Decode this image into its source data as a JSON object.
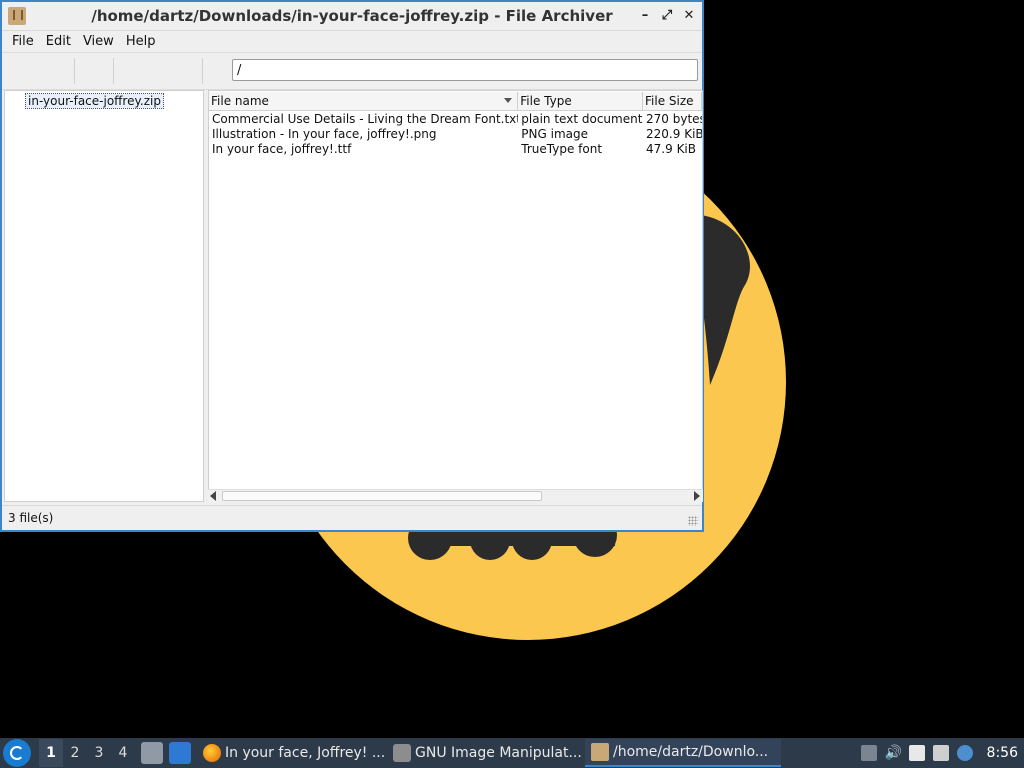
{
  "window": {
    "title": "/home/dartz/Downloads/in-your-face-joffrey.zip - File Archiver",
    "controls": {
      "minimize": "–",
      "maximize": "⤢",
      "close": "✕"
    }
  },
  "menu": [
    "File",
    "Edit",
    "View",
    "Help"
  ],
  "path": {
    "value": "/"
  },
  "tree": {
    "root_label": "in-your-face-joffrey.zip"
  },
  "columns": [
    "File name",
    "File Type",
    "File Size"
  ],
  "files": [
    {
      "name": "Commercial Use Details - Living the Dream Font.txt",
      "type": "plain text document",
      "size": "270 bytes"
    },
    {
      "name": "Illustration - In your face, joffrey!.png",
      "type": "PNG image",
      "size": "220.9 KiB"
    },
    {
      "name": "In your face, joffrey!.ttf",
      "type": "TrueType font",
      "size": "47.9 KiB"
    }
  ],
  "status": {
    "text": "3 file(s)"
  },
  "taskbar": {
    "workspaces": [
      "1",
      "2",
      "3",
      "4"
    ],
    "active_workspace": "1",
    "tasks": [
      {
        "id": "firefox",
        "label": "In your face, Joffrey! ..."
      },
      {
        "id": "gimp",
        "label": "GNU Image Manipulat..."
      },
      {
        "id": "archiver",
        "label": "/home/dartz/Downlo..."
      }
    ],
    "clock": "8:56"
  },
  "colors": {
    "accent": "#3d86c6",
    "wallpaper_face": "#fbc74f",
    "taskbar": "#2c3a4a"
  }
}
